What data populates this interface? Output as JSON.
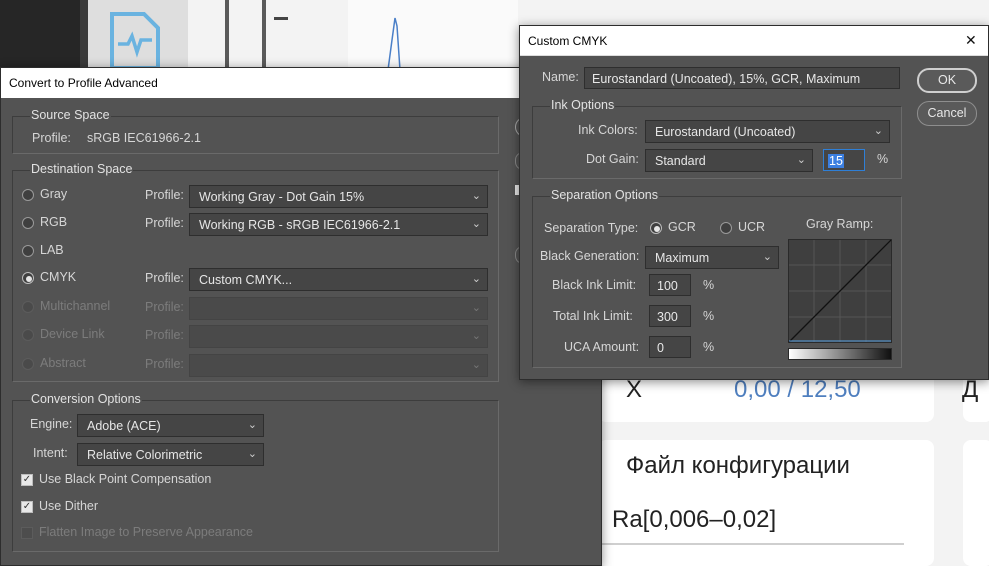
{
  "background": {
    "row1_label": "X",
    "row1_value": "0,00 / 12,50",
    "row2_title": "Файл конфигурации",
    "row2_value": "Ra[0,006–0,02]",
    "right_edge_char": "Д"
  },
  "convert_dialog": {
    "title": "Convert to Profile Advanced",
    "source_space": {
      "heading": "Source Space",
      "profile_label": "Profile:",
      "profile_value": "sRGB IEC61966-2.1"
    },
    "destination_space": {
      "heading": "Destination Space",
      "profile_label": "Profile:",
      "options": [
        {
          "label": "Gray",
          "profile": "Working Gray - Dot Gain 15%"
        },
        {
          "label": "RGB",
          "profile": "Working RGB - sRGB IEC61966-2.1"
        },
        {
          "label": "LAB",
          "profile": ""
        },
        {
          "label": "CMYK",
          "profile": "Custom CMYK..."
        },
        {
          "label": "Multichannel",
          "profile": ""
        },
        {
          "label": "Device Link",
          "profile": ""
        },
        {
          "label": "Abstract",
          "profile": ""
        }
      ],
      "selected": "CMYK"
    },
    "conversion_options": {
      "heading": "Conversion Options",
      "engine_label": "Engine:",
      "engine_value": "Adobe (ACE)",
      "intent_label": "Intent:",
      "intent_value": "Relative Colorimetric",
      "use_bpc": "Use Black Point Compensation",
      "use_bpc_checked": true,
      "use_dither": "Use Dither",
      "use_dither_checked": true,
      "flatten": "Flatten Image to Preserve Appearance",
      "flatten_checked": false
    }
  },
  "cmyk_dialog": {
    "title": "Custom CMYK",
    "close_glyph": "✕",
    "name_label": "Name:",
    "name_value": "Eurostandard (Uncoated), 15%, GCR, Maximum",
    "ok_label": "OK",
    "cancel_label": "Cancel",
    "ink_options": {
      "heading": "Ink Options",
      "ink_colors_label": "Ink Colors:",
      "ink_colors_value": "Eurostandard (Uncoated)",
      "dot_gain_label": "Dot Gain:",
      "dot_gain_value": "Standard",
      "dot_gain_amount": "15",
      "percent": "%"
    },
    "separation_options": {
      "heading": "Separation Options",
      "separation_type_label": "Separation Type:",
      "gcr_label": "GCR",
      "ucr_label": "UCR",
      "selected_type": "GCR",
      "black_generation_label": "Black Generation:",
      "black_generation_value": "Maximum",
      "black_ink_limit_label": "Black Ink Limit:",
      "black_ink_limit_value": "100",
      "total_ink_limit_label": "Total Ink Limit:",
      "total_ink_limit_value": "300",
      "uca_amount_label": "UCA Amount:",
      "uca_amount_value": "0",
      "percent": "%",
      "gray_ramp_label": "Gray Ramp:"
    }
  },
  "colors": {
    "dialog_bg": "#535353",
    "field_bg": "#454545",
    "focus_blue": "#3c7fe0",
    "background_value_blue": "#4f7fbf",
    "doc_icon_blue": "#6ab3e0"
  },
  "icons": {
    "doc_icon": "document-chart-icon",
    "dropdown": "chevron-down-icon",
    "close": "close-icon"
  }
}
